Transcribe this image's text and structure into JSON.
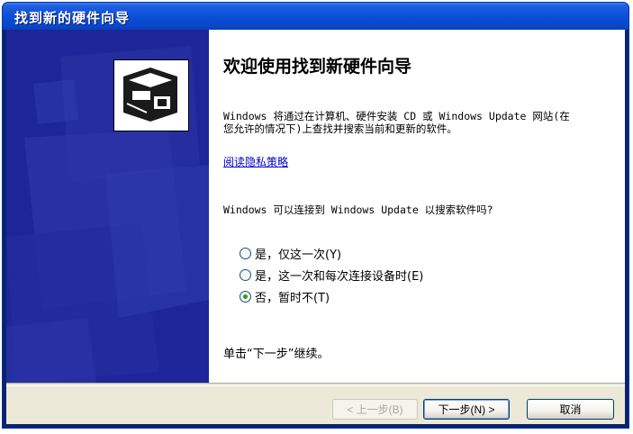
{
  "window": {
    "title": "找到新的硬件向导"
  },
  "wizard": {
    "heading": "欢迎使用找到新硬件向导",
    "description": "Windows 将通过在计算机、硬件安装 CD 或 Windows Update 网站(在您允许的情况下)上查找并搜索当前和更新的软件。",
    "privacy_link": "阅读隐私策略",
    "question": "Windows 可以连接到 Windows Update 以搜索软件吗?",
    "options": [
      {
        "label": "是，仅这一次(Y)",
        "checked": false
      },
      {
        "label": "是，这一次和每次连接设备时(E)",
        "checked": false
      },
      {
        "label": "否，暂时不(T)",
        "checked": true
      }
    ],
    "continue_text": "单击“下一步”继续。"
  },
  "buttons": {
    "back": "< 上一步(B)",
    "next": "下一步(N) >",
    "cancel": "取消"
  },
  "colors": {
    "titlebar": "#0b4fd8",
    "side_panel": "#1c2698",
    "dialog_bg": "#ece9d8",
    "link": "#0000cc"
  },
  "icons": {
    "wizard_icon": "hardware-card-icon"
  }
}
